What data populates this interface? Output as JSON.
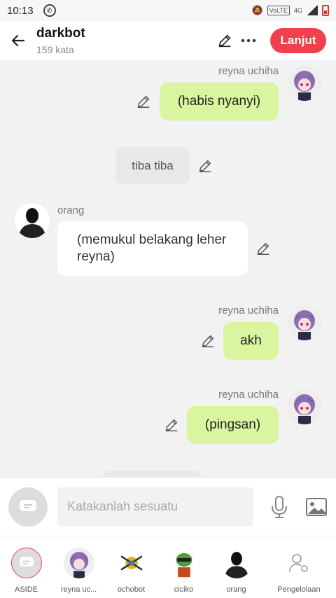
{
  "status_bar": {
    "time": "10:13",
    "network": "4G",
    "volte": "VoLTE"
  },
  "header": {
    "title": "darkbot",
    "subtitle": "159 kata",
    "next_label": "Lanjut"
  },
  "messages": [
    {
      "type": "me",
      "sender": "reyna uchiha",
      "text": "(habis nyanyi)"
    },
    {
      "type": "narration",
      "text": "tiba tiba"
    },
    {
      "type": "other",
      "sender": "orang",
      "text": "(memukul belakang leher reyna)"
    },
    {
      "type": "me",
      "sender": "reyna uchiha",
      "text": "akh"
    },
    {
      "type": "me",
      "sender": "reyna uchiha",
      "text": "(pingsan)"
    }
  ],
  "input": {
    "placeholder": "Katakanlah sesuatu"
  },
  "characters": [
    {
      "label": "ASIDE"
    },
    {
      "label": "reyna uc..."
    },
    {
      "label": "ochobot"
    },
    {
      "label": "ciciko"
    },
    {
      "label": "orang"
    },
    {
      "label": "Pengelolaan"
    }
  ],
  "colors": {
    "accent": "#f0404b",
    "my_bubble": "#d9f59f",
    "background": "#f2f2f2"
  }
}
